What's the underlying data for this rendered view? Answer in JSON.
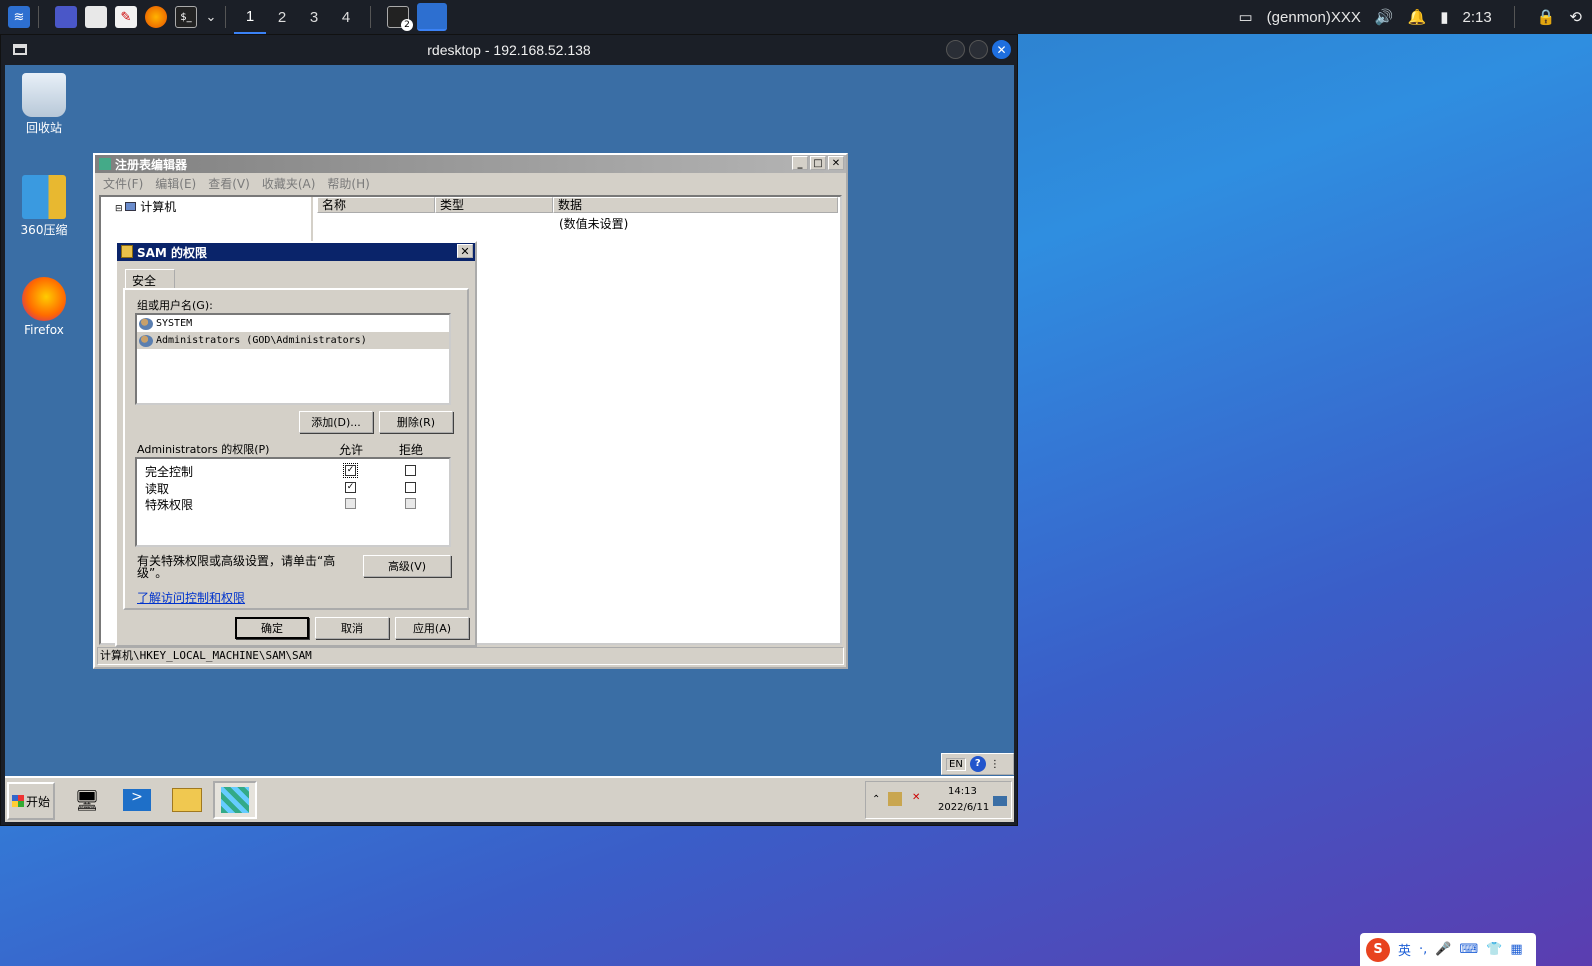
{
  "top_panel": {
    "workspaces": [
      "1",
      "2",
      "3",
      "4"
    ],
    "badge": "2",
    "genmon": "(genmon)XXX",
    "clock": "2:13",
    "accent": "#3b82f6"
  },
  "rdesktop": {
    "title": "rdesktop - 192.168.52.138"
  },
  "desktop_icons": [
    {
      "label": "回收站",
      "icon": "recycle-bin-icon"
    },
    {
      "label": "360压缩",
      "icon": "archive-icon"
    },
    {
      "label": "Firefox",
      "icon": "firefox-icon"
    }
  ],
  "regedit": {
    "title": "注册表编辑器",
    "menu": [
      "文件(F)",
      "编辑(E)",
      "查看(V)",
      "收藏夹(A)",
      "帮助(H)"
    ],
    "tree_root": "计算机",
    "columns": [
      "名称",
      "类型",
      "数据"
    ],
    "data_value": "(数值未设置)",
    "status": "计算机\\HKEY_LOCAL_MACHINE\\SAM\\SAM"
  },
  "perm_dialog": {
    "title": "SAM 的权限",
    "tab": "安全",
    "group_label": "组或用户名(G):",
    "users": [
      "SYSTEM",
      "Administrators (GOD\\Administrators)"
    ],
    "add_button": "添加(D)...",
    "remove_button": "删除(R)",
    "perm_label": "Administrators 的权限(P)",
    "allow_label": "允许",
    "deny_label": "拒绝",
    "permissions": [
      {
        "name": "完全控制",
        "allow": "✓",
        "deny": ""
      },
      {
        "name": "读取",
        "allow": "✓",
        "deny": ""
      },
      {
        "name": "特殊权限",
        "allow": "",
        "deny": ""
      }
    ],
    "advanced_text": "有关特殊权限或高级设置，请单击“高级”。",
    "advanced_button": "高级(V)",
    "link": "了解访问控制和权限",
    "ok": "确定",
    "cancel": "取消",
    "apply": "应用(A)"
  },
  "win_taskbar": {
    "start": "开始",
    "lang": "EN",
    "time": "14:13",
    "date": "2022/6/11"
  },
  "ime": {
    "lang": "英"
  }
}
